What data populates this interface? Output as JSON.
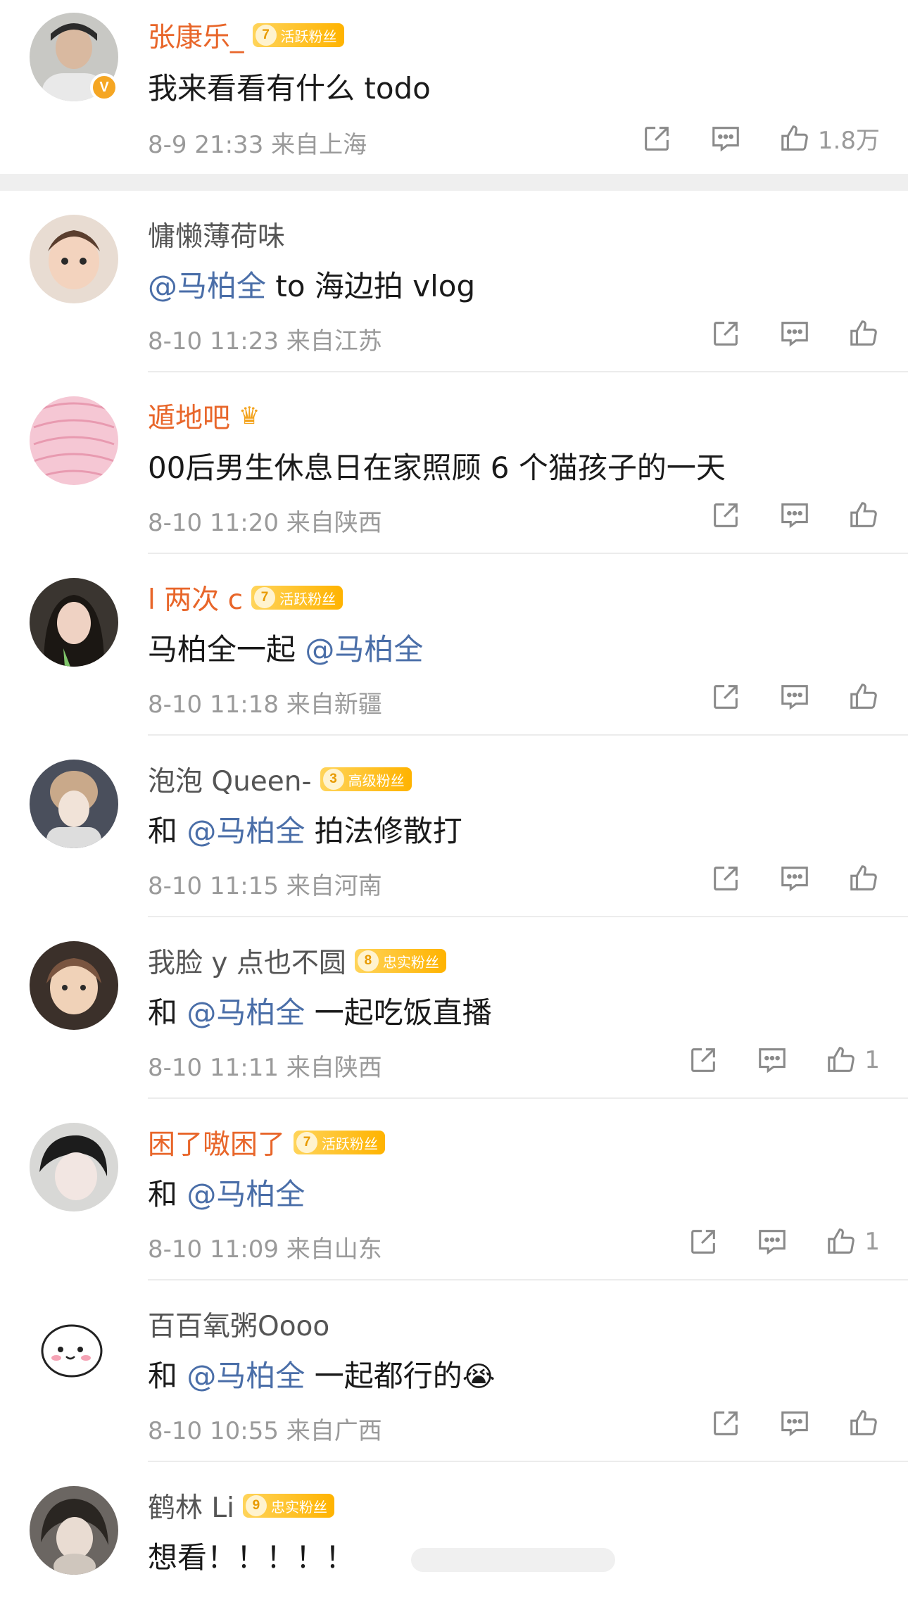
{
  "pinned": {
    "name": "张康乐_",
    "badge": {
      "level": "7",
      "label": "活跃粉丝"
    },
    "verified_mark": "V",
    "text": "我来看看有什么 todo",
    "meta": "8-9 21:33 来自上海",
    "likes": "1.8万"
  },
  "comments": [
    {
      "name": "慵懒薄荷味",
      "mention": "@马柏全",
      "text_after": " to 海边拍 vlog",
      "meta": "8-10 11:23 来自江苏"
    },
    {
      "name": "遁地吧",
      "crown": "♛",
      "text": "00后男生休息日在家照顾 6 个猫孩子的一天",
      "meta": "8-10 11:20 来自陕西"
    },
    {
      "name": "l 两次 c",
      "badge": {
        "level": "7",
        "label": "活跃粉丝"
      },
      "text_before": "马柏全一起 ",
      "mention": "@马柏全",
      "meta": "8-10 11:18 来自新疆"
    },
    {
      "name": "泡泡 Queen-",
      "badge": {
        "level": "3",
        "label": "高级粉丝"
      },
      "text_before": "和 ",
      "mention": "@马柏全",
      "text_after": " 拍法修散打",
      "meta": "8-10 11:15 来自河南"
    },
    {
      "name": "我脸 y 点也不圆",
      "badge": {
        "level": "8",
        "label": "忠实粉丝"
      },
      "text_before": "和 ",
      "mention": "@马柏全",
      "text_after": " 一起吃饭直播",
      "meta": "8-10 11:11 来自陕西",
      "likes": "1"
    },
    {
      "name": "困了嗷困了",
      "badge": {
        "level": "7",
        "label": "活跃粉丝"
      },
      "text_before": "和 ",
      "mention": "@马柏全",
      "meta": "8-10 11:09 来自山东",
      "likes": "1"
    },
    {
      "name": "百百氧粥Oooo",
      "text_before": "和 ",
      "mention": "@马柏全",
      "text_after": " 一起都行的",
      "emoji": "😭",
      "meta": "8-10 10:55 来自广西"
    },
    {
      "name": "鹤林 Li",
      "badge": {
        "level": "9",
        "label": "忠实粉丝"
      },
      "text": "想看！！！！！"
    }
  ],
  "colors": {
    "accent_name": "#e8662a",
    "mention": "#4a6ea8",
    "meta": "#9a9a9a",
    "badge": "#ffb300"
  }
}
